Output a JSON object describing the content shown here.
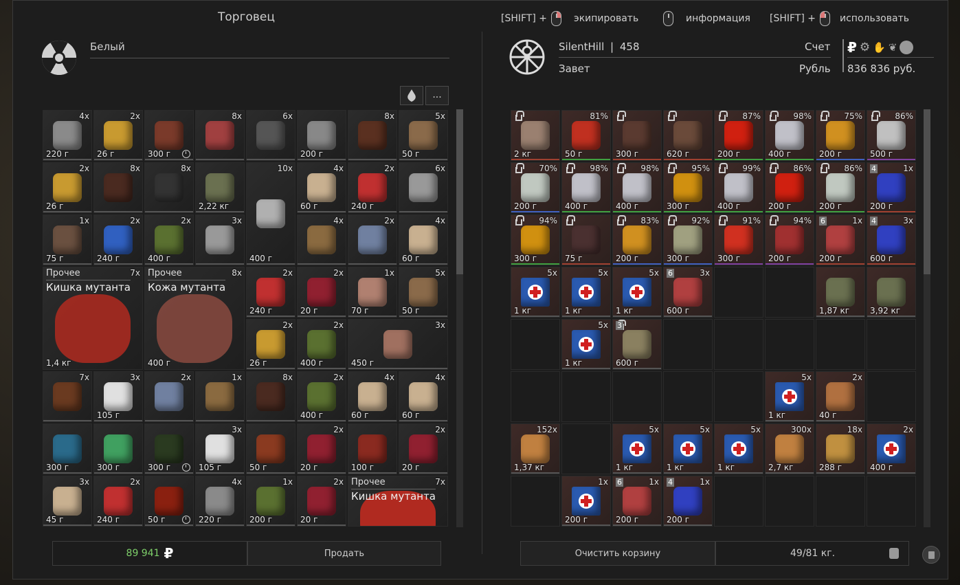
{
  "trader": {
    "title": "Торговец",
    "faction": "Белый",
    "filter_more": "...",
    "money": "89 941",
    "currency_glyph": "₽",
    "sell_label": "Продать"
  },
  "hints": [
    {
      "prefix": "[SHIFT] +",
      "label": "экипировать",
      "button": "r"
    },
    {
      "prefix": "",
      "label": "информация",
      "button": ""
    },
    {
      "prefix": "[SHIFT] +",
      "label": "использовать",
      "button": "l"
    }
  ],
  "player": {
    "name": "SilentHill",
    "separator": "|",
    "level": "458",
    "group": "Завет",
    "account_label": "Счет",
    "currency_label": "Рубль",
    "balance": "836 836 руб.",
    "clear_cart_label": "Очистить корзину",
    "weight": "49/81 кг."
  },
  "trader_items": [
    {
      "q": "4x",
      "w": "220 г",
      "c": "#8a8a8a"
    },
    {
      "q": "2x",
      "w": "26 г",
      "c": "#c89a30"
    },
    {
      "q": "",
      "w": "300 г",
      "c": "#7a3a2a",
      "clock": true
    },
    {
      "q": "8x",
      "w": "",
      "c": "#a04040"
    },
    {
      "q": "6x",
      "w": "",
      "c": "#555"
    },
    {
      "q": "",
      "w": "200 г",
      "c": "#888"
    },
    {
      "q": "8x",
      "w": "",
      "c": "#5a3020"
    },
    {
      "q": "5x",
      "w": "50 г",
      "c": "#8a6a4a"
    },
    {
      "q": "2x",
      "w": "26 г",
      "c": "#c89a30"
    },
    {
      "q": "8x",
      "w": "",
      "c": "#4a2a20"
    },
    {
      "q": "8x",
      "w": "",
      "c": "#333"
    },
    {
      "q": "",
      "w": "2,22 кг",
      "c": "#6a7050"
    },
    {
      "q": "10x",
      "w": "400 г",
      "c": "#b0b0b0",
      "tall": true
    },
    {
      "q": "4x",
      "w": "60 г",
      "c": "#c8b090"
    },
    {
      "q": "2x",
      "w": "240 г",
      "c": "#c03030"
    },
    {
      "q": "6x",
      "w": "",
      "c": "#999"
    },
    {
      "q": "1x",
      "w": "75 г",
      "c": "#6a5040"
    },
    {
      "q": "2x",
      "w": "240 г",
      "c": "#3060c0"
    },
    {
      "q": "2x",
      "w": "400 г",
      "c": "#5a7030"
    },
    {
      "q": "3x",
      "w": "",
      "c": "#999"
    },
    {
      "q": "4x",
      "w": "",
      "c": "#8a6a40"
    },
    {
      "q": "2x",
      "w": "",
      "c": "#7080a0"
    },
    {
      "q": "4x",
      "w": "60 г",
      "c": "#c8b090"
    }
  ],
  "mutant": {
    "cat": "Прочее",
    "gut_name": "Кишка мутанта",
    "gut_qty": "7x",
    "gut_w": "1,4 кг",
    "skin_name": "Кожа мутанта",
    "skin_qty": "8x",
    "skin_w": "400 г"
  },
  "trader_items2": [
    {
      "q": "2x",
      "w": "240 г",
      "c": "#c03030"
    },
    {
      "q": "2x",
      "w": "20 г",
      "c": "#902030"
    },
    {
      "q": "1x",
      "w": "70 г",
      "c": "#b08070"
    },
    {
      "q": "5x",
      "w": "50 г",
      "c": "#8a6a4a"
    },
    {
      "q": "2x",
      "w": "26 г",
      "c": "#c89a30"
    },
    {
      "q": "2x",
      "w": "400 г",
      "c": "#5a7030"
    },
    {
      "q": "3x",
      "w": "450 г",
      "c": "#a07060",
      "wide": true
    }
  ],
  "trader_rows": [
    [
      {
        "q": "7x",
        "w": "",
        "c": "#6a3a20"
      },
      {
        "q": "3x",
        "w": "105 г",
        "c": "#e0e0e0"
      },
      {
        "q": "2x",
        "w": "",
        "c": "#7080a0"
      },
      {
        "q": "1x",
        "w": "",
        "c": "#8a6a40"
      },
      {
        "q": "8x",
        "w": "",
        "c": "#4a2a20"
      },
      {
        "q": "2x",
        "w": "400 г",
        "c": "#5a7030"
      },
      {
        "q": "4x",
        "w": "60 г",
        "c": "#c8b090"
      },
      {
        "q": "4x",
        "w": "60 г",
        "c": "#c8b090"
      }
    ],
    [
      {
        "q": "",
        "w": "300 г",
        "c": "#2a6a8a"
      },
      {
        "q": "",
        "w": "300 г",
        "c": "#40a060"
      },
      {
        "q": "",
        "w": "300 г",
        "c": "#2a3a20",
        "clock": true
      },
      {
        "q": "3x",
        "w": "105 г",
        "c": "#e0e0e0"
      },
      {
        "q": "",
        "w": "50 г",
        "c": "#8a3a20"
      },
      {
        "q": "2x",
        "w": "20 г",
        "c": "#902030"
      },
      {
        "q": "",
        "w": "100 г",
        "c": "#8a2a20"
      },
      {
        "q": "2x",
        "w": "20 г",
        "c": "#902030"
      }
    ],
    [
      {
        "q": "3x",
        "w": "45 г",
        "c": "#c8b090"
      },
      {
        "q": "2x",
        "w": "240 г",
        "c": "#c03030"
      },
      {
        "q": "",
        "w": "50 г",
        "c": "#8a2010",
        "clock": true
      },
      {
        "q": "4x",
        "w": "220 г",
        "c": "#8a8a8a"
      },
      {
        "q": "1x",
        "w": "200 г",
        "c": "#5a7030"
      },
      {
        "q": "2x",
        "w": "20 г",
        "c": "#902030"
      }
    ]
  ],
  "gut2": {
    "cat": "Прочее",
    "name": "Кишка мутанта",
    "qty": "7x"
  },
  "cart_rows": [
    [
      {
        "p": "",
        "w": "2 кг",
        "c": "#9a8070",
        "lock": true,
        "bar": "#a04030"
      },
      {
        "p": "81%",
        "w": "50 г",
        "c": "#c03020",
        "bar": "#40a040"
      },
      {
        "p": "",
        "w": "300 г",
        "c": "#5a3a30",
        "lock": true,
        "bar": "#a04030"
      },
      {
        "p": "",
        "w": "620 г",
        "c": "#6a4a3a",
        "lock": true,
        "bar": "#a04030"
      },
      {
        "p": "87%",
        "w": "200 г",
        "c": "#d02010",
        "lock": true,
        "bar": "#40a040"
      },
      {
        "p": "98%",
        "w": "400 г",
        "c": "#c0c0c8",
        "lock": true,
        "bar": "#40a040"
      },
      {
        "p": "75%",
        "w": "200 г",
        "c": "#d09020",
        "lock": true,
        "bar": "#4060c0"
      },
      {
        "p": "86%",
        "w": "500 г",
        "c": "#c0c0c0",
        "lock": true,
        "bar": "#8040a0"
      }
    ],
    [
      {
        "p": "70%",
        "w": "200 г",
        "c": "#c0c8c0",
        "lock": true,
        "bar": "#4060c0"
      },
      {
        "p": "98%",
        "w": "400 г",
        "c": "#c0c0c8",
        "lock": true,
        "bar": "#40a040"
      },
      {
        "p": "98%",
        "w": "400 г",
        "c": "#c0c0c8",
        "lock": true,
        "bar": "#40a040"
      },
      {
        "p": "95%",
        "w": "300 г",
        "c": "#d09010",
        "lock": true,
        "bar": "#40a040"
      },
      {
        "p": "99%",
        "w": "400 г",
        "c": "#c0c0c8",
        "lock": true,
        "bar": "#40a040"
      },
      {
        "p": "86%",
        "w": "200 г",
        "c": "#d02010",
        "lock": true,
        "bar": "#40a040"
      },
      {
        "p": "86%",
        "w": "200 г",
        "c": "#c0c8c0",
        "lock": true,
        "bar": "#40a040"
      },
      {
        "p": "1x",
        "w": "200 г",
        "c": "#3040c0",
        "tag": "4",
        "bar": "#a04030"
      }
    ],
    [
      {
        "p": "94%",
        "w": "300 г",
        "c": "#d09010",
        "lock": true,
        "bar": "#40a040"
      },
      {
        "p": "",
        "w": "75 г",
        "c": "#4a3030",
        "lock": true,
        "bar": "#a04030"
      },
      {
        "p": "83%",
        "w": "200 г",
        "c": "#d09020",
        "lock": true,
        "bar": "#4060c0"
      },
      {
        "p": "92%",
        "w": "300 г",
        "c": "#a0a080",
        "lock": true,
        "bar": "#4060c0"
      },
      {
        "p": "91%",
        "w": "300 г",
        "c": "#d03020",
        "lock": true,
        "bar": "#8040a0"
      },
      {
        "p": "94%",
        "w": "200 г",
        "c": "#a03030",
        "lock": true,
        "bar": "#8040a0"
      },
      {
        "p": "1x",
        "w": "200 г",
        "c": "#b04040",
        "tag": "6",
        "bar": "#a04030"
      },
      {
        "p": "3x",
        "w": "600 г",
        "c": "#3040c0",
        "tag": "4",
        "bar": "#a04030"
      }
    ],
    [
      {
        "p": "5x",
        "w": "1 кг",
        "c": "#3060c0",
        "kit": true
      },
      {
        "p": "5x",
        "w": "1 кг",
        "c": "#3060c0",
        "kit": true
      },
      {
        "p": "5x",
        "w": "1 кг",
        "c": "#3060c0",
        "kit": true
      },
      {
        "p": "3x",
        "w": "600 г",
        "c": "#b04040",
        "tag": "6"
      },
      {
        "e": true
      },
      {
        "e": true
      },
      {
        "p": "",
        "w": "1,87 кг",
        "c": "#6a7050"
      },
      {
        "p": "",
        "w": "3,92 кг",
        "c": "#6a7050"
      }
    ],
    [
      {
        "e": true
      },
      {
        "p": "5x",
        "w": "1 кг",
        "c": "#3060c0",
        "kit": true
      },
      {
        "p": "",
        "w": "600 г",
        "c": "#8a8060",
        "lock": true,
        "tag": "3"
      },
      {
        "e": true
      },
      {
        "e": true
      },
      {
        "e": true
      },
      {
        "e": true
      },
      {
        "e": true
      }
    ],
    [
      {
        "e": true
      },
      {
        "e": true
      },
      {
        "e": true
      },
      {
        "e": true
      },
      {
        "e": true
      },
      {
        "p": "5x",
        "w": "1 кг",
        "c": "#3060c0",
        "kit": true
      },
      {
        "p": "2x",
        "w": "40 г",
        "c": "#b07040"
      },
      {
        "e": true
      }
    ],
    [
      {
        "p": "152x",
        "w": "1,37 кг",
        "c": "#c08040"
      },
      {
        "e": true
      },
      {
        "p": "5x",
        "w": "1 кг",
        "c": "#3060c0",
        "kit": true
      },
      {
        "p": "5x",
        "w": "1 кг",
        "c": "#3060c0",
        "kit": true
      },
      {
        "p": "5x",
        "w": "1 кг",
        "c": "#3060c0",
        "kit": true
      },
      {
        "p": "300x",
        "w": "2,7 кг",
        "c": "#c08040"
      },
      {
        "p": "18x",
        "w": "288 г",
        "c": "#c09040"
      },
      {
        "p": "2x",
        "w": "400 г",
        "c": "#3060c0",
        "kit": true
      }
    ],
    [
      {
        "e": true
      },
      {
        "p": "1x",
        "w": "200 г",
        "c": "#3060c0",
        "kit": true
      },
      {
        "p": "1x",
        "w": "200 г",
        "c": "#b04040",
        "tag": "6"
      },
      {
        "p": "1x",
        "w": "200 г",
        "c": "#3040c0",
        "tag": "4"
      },
      {
        "e": true
      },
      {
        "e": true
      },
      {
        "e": true
      },
      {
        "e": true
      }
    ]
  ],
  "currency_icons": [
    "ruble-icon",
    "gear-icon",
    "hand-icon",
    "leaf-icon",
    "coin-icon"
  ]
}
